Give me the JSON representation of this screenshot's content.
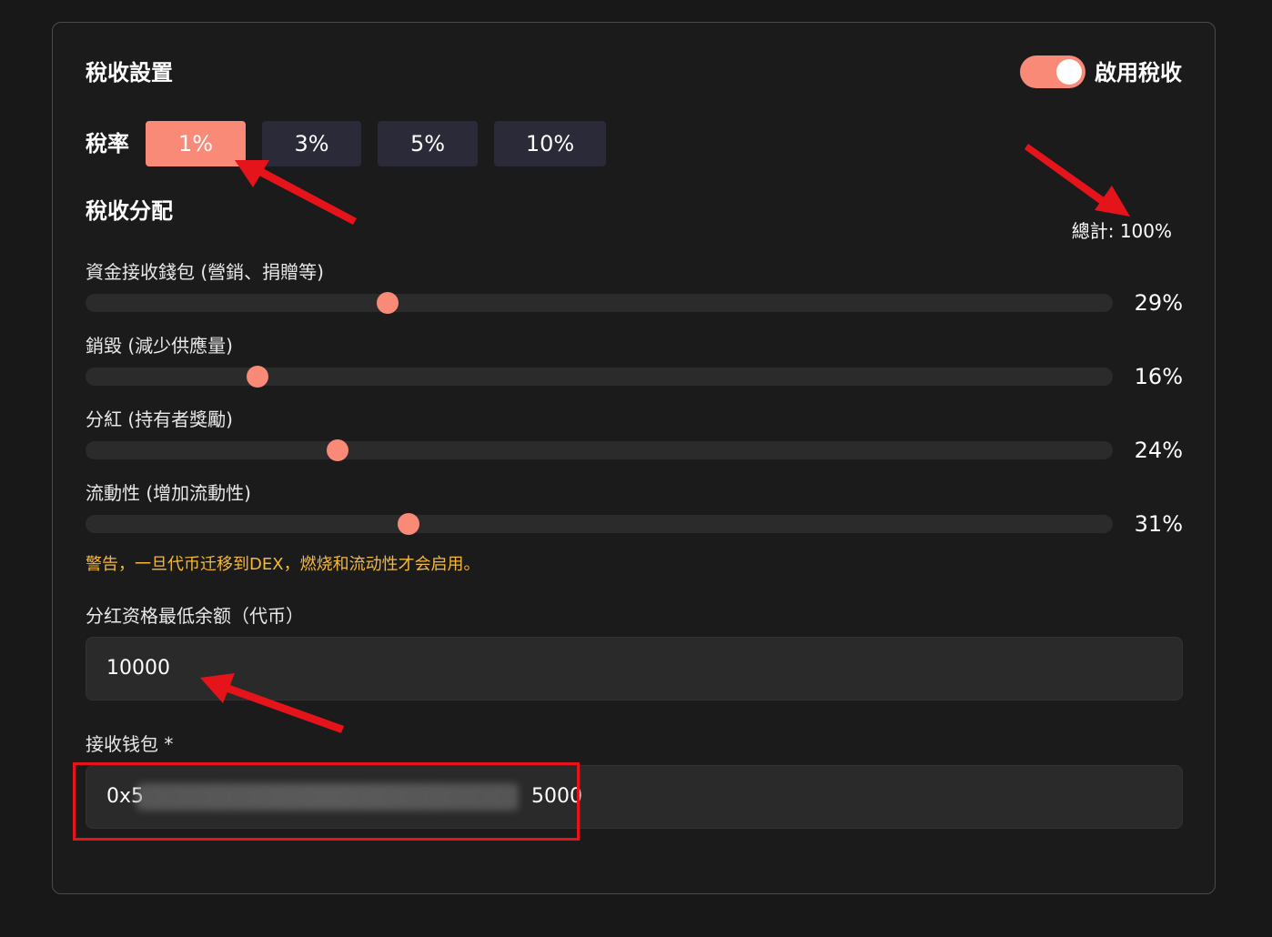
{
  "tax_settings": {
    "title": "稅收設置",
    "toggle_label": "啟用稅收",
    "toggle_on": true,
    "rate_label": "稅率",
    "rates": [
      "1%",
      "3%",
      "5%",
      "10%"
    ],
    "selected_rate": "1%"
  },
  "distribution": {
    "title": "稅收分配",
    "total": "總計: 100%",
    "items": [
      {
        "label": "資金接收錢包 (營銷、捐贈等)",
        "value": 29,
        "display": "29%"
      },
      {
        "label": "銷毀 (減少供應量)",
        "value": 16,
        "display": "16%"
      },
      {
        "label": "分紅 (持有者獎勵)",
        "value": 24,
        "display": "24%"
      },
      {
        "label": "流動性 (增加流動性)",
        "value": 31,
        "display": "31%"
      }
    ],
    "warning": "警告，一旦代币迁移到DEX，燃烧和流动性才会启用。"
  },
  "fields": {
    "min_balance_label": "分红资格最低余额（代币）",
    "min_balance_value": "10000",
    "wallet_label": "接收钱包 *",
    "wallet_prefix": "0x5",
    "wallet_suffix": "5000"
  },
  "colors": {
    "accent": "#f98a78",
    "warning": "#f5b83a",
    "annotation": "#e5141b"
  }
}
